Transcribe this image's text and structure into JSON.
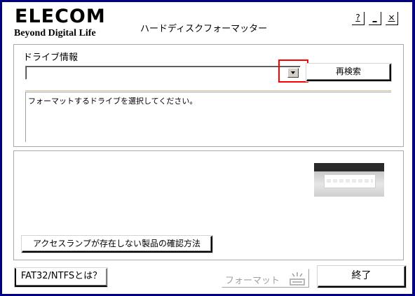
{
  "brand": {
    "logo": "ELECOM",
    "tagline": "Beyond Digital Life"
  },
  "window": {
    "title": "ハードディスクフォーマッター",
    "controls": {
      "help": "?",
      "minimize": "_",
      "close": "×"
    }
  },
  "drive_section": {
    "label": "ドライブ情報",
    "selected_drive": "",
    "rescan_label": "再検索",
    "message": "フォーマットするドライブを選択してください。"
  },
  "lamp_section": {
    "check_button_label": "アクセスランプが存在しない製品の確認方法"
  },
  "footer": {
    "fat32_button_label": "FAT32/NTFSとは？",
    "format_button_label": "フォーマット",
    "exit_button_label": "終了"
  },
  "colors": {
    "frame": "#000080",
    "highlight": "#ff0000",
    "disabled_text": "#a0a0a0"
  }
}
